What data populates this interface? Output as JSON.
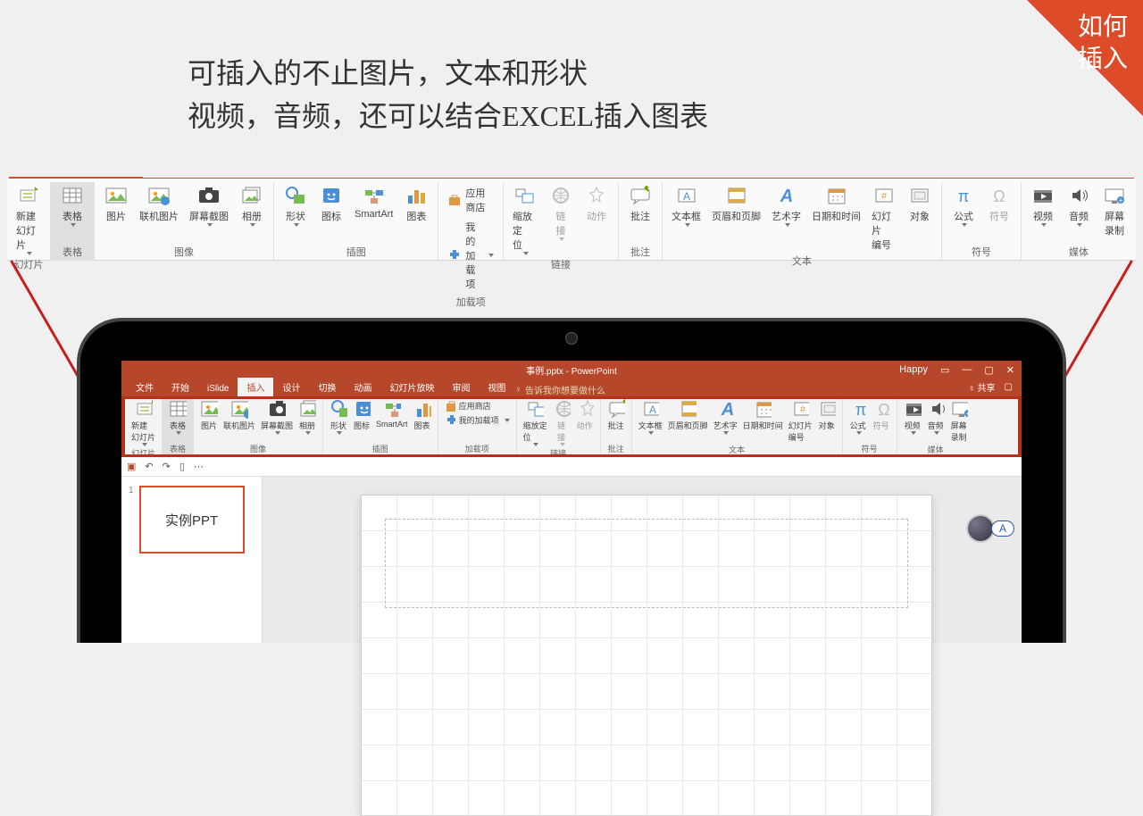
{
  "corner_label": "如何\n插入",
  "headline_line1": "可插入的不止图片，文本和形状",
  "headline_line2": "视频，音频，还可以结合EXCEL插入图表",
  "ribbon": {
    "groups": {
      "slides": {
        "name": "幻灯片",
        "new_slide": "新建\n幻灯片"
      },
      "table": {
        "name": "表格",
        "table": "表格"
      },
      "images": {
        "name": "图像",
        "picture": "图片",
        "online_picture": "联机图片",
        "screenshot": "屏幕截图",
        "album": "相册"
      },
      "illustrations": {
        "name": "插图",
        "shapes": "形状",
        "icons": "图标",
        "smartart": "SmartArt",
        "chart": "图表"
      },
      "addins": {
        "name": "加载项",
        "store": "应用商店",
        "my_addins": "我的加载项"
      },
      "links": {
        "name": "链接",
        "zoom": "缩放定位",
        "link": "链接",
        "action": "动作"
      },
      "comments": {
        "name": "批注",
        "comment": "批注"
      },
      "text": {
        "name": "文本",
        "textbox": "文本框",
        "header_footer": "页眉和页脚",
        "wordart": "艺术字",
        "datetime": "日期和时间",
        "slide_number": "幻灯片编号",
        "object": "对象"
      },
      "symbols": {
        "name": "符号",
        "equation": "公式",
        "symbol": "符号"
      },
      "media": {
        "name": "媒体",
        "video": "视频",
        "audio": "音频",
        "screen_rec": "屏幕录制"
      }
    }
  },
  "ppt": {
    "title": "事例.pptx - PowerPoint",
    "user": "Happy",
    "tabs": {
      "file": "文件",
      "home": "开始",
      "islide": "iSlide",
      "insert": "插入",
      "design": "设计",
      "transition": "切换",
      "animation": "动画",
      "slideshow": "幻灯片放映",
      "review": "审阅",
      "view": "视图"
    },
    "tell_me": "告诉我你想要做什么",
    "share": "共享",
    "thumb_number": "1",
    "thumb_label": "实例PPT",
    "avatar_label": "A"
  }
}
